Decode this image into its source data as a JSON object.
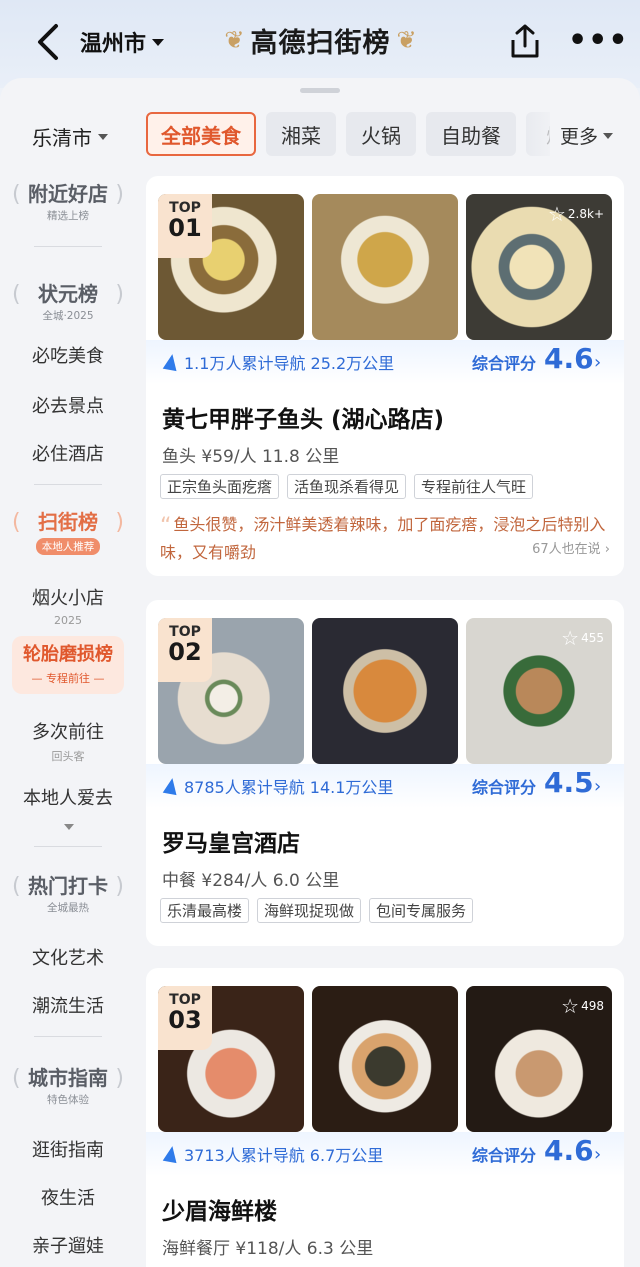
{
  "header": {
    "city": "温州市",
    "brand_title": "高德扫街榜"
  },
  "filters": {
    "district": "乐清市",
    "chips": [
      "全部美食",
      "湘菜",
      "火锅",
      "自助餐",
      "烧"
    ],
    "more": "更多"
  },
  "sidebar": {
    "badge1": {
      "title": "附近好店",
      "sub": "精选上榜"
    },
    "badge2": {
      "title": "状元榜",
      "sub": "全城·2025"
    },
    "items_a": [
      "必吃美食",
      "必去景点",
      "必住酒店"
    ],
    "badge3": {
      "title": "扫街榜",
      "sub": "本地人推荐"
    },
    "item_yanhuo": {
      "title": "烟火小店",
      "sub": "2025"
    },
    "active": {
      "title": "轮胎磨损榜",
      "sub": "— 专程前往 —"
    },
    "item_duoci": {
      "title": "多次前往",
      "sub": "回头客"
    },
    "item_bendi": "本地人爱去",
    "badge4": {
      "title": "热门打卡",
      "sub": "全城最热"
    },
    "items_b": [
      "文化艺术",
      "潮流生活"
    ],
    "badge5": {
      "title": "城市指南",
      "sub": "特色体验"
    },
    "items_c": [
      "逛街指南",
      "夜生活",
      "亲子遛娃"
    ]
  },
  "cards": [
    {
      "rank_top": "TOP",
      "rank": "01",
      "fav_count": "2.8k+",
      "nav": "1.1万人累计导航 25.2万公里",
      "score_label": "综合评分",
      "score": "4.6",
      "name": "黄七甲胖子鱼头 (湖心路店)",
      "info": "鱼头 ¥59/人 11.8 公里",
      "tags": [
        "正宗鱼头面疙瘩",
        "活鱼现杀看得见",
        "专程前往人气旺"
      ],
      "review": "鱼头很赞，汤汁鲜美透着辣味，加了面疙瘩，浸泡之后特别入味，又有嚼劲",
      "also": "67人也在说"
    },
    {
      "rank_top": "TOP",
      "rank": "02",
      "fav_count": "455",
      "nav": "8785人累计导航 14.1万公里",
      "score_label": "综合评分",
      "score": "4.5",
      "name": "罗马皇宫酒店",
      "info": "中餐 ¥284/人 6.0 公里",
      "tags": [
        "乐清最高楼",
        "海鲜现捉现做",
        "包间专属服务"
      ]
    },
    {
      "rank_top": "TOP",
      "rank": "03",
      "fav_count": "498",
      "nav": "3713人累计导航 6.7万公里",
      "score_label": "综合评分",
      "score": "4.6",
      "name": "少眉海鲜楼",
      "info": "海鲜餐厅 ¥118/人 6.3 公里"
    }
  ]
}
